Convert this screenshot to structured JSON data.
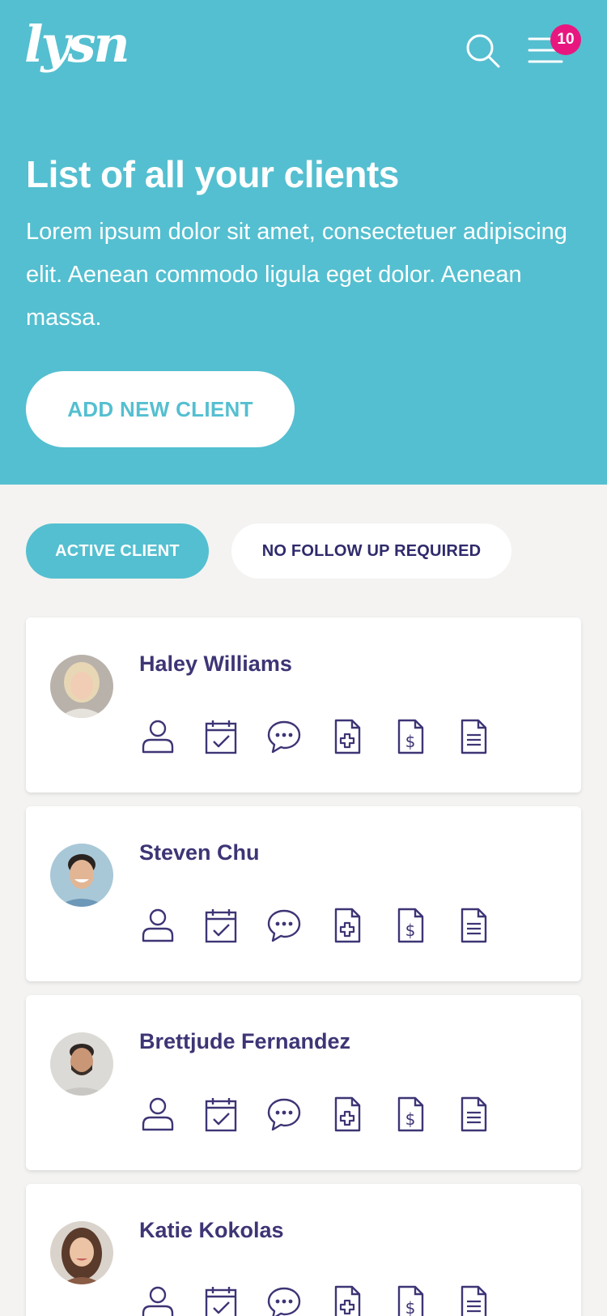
{
  "header": {
    "logo": "lysn",
    "notification_count": "10"
  },
  "hero": {
    "title": "List of all your clients",
    "description": "Lorem ipsum dolor sit amet, consectetuer adipiscing elit. Aenean commodo ligula eget dolor. Aenean massa.",
    "add_button": "ADD NEW CLIENT"
  },
  "filters": {
    "active": "ACTIVE CLIENT",
    "inactive": "NO FOLLOW UP REQUIRED"
  },
  "clients": [
    {
      "name": "Haley Williams"
    },
    {
      "name": "Steven Chu"
    },
    {
      "name": "Brettjude Fernandez"
    },
    {
      "name": "Katie Kokolas"
    }
  ],
  "action_icons": [
    "profile-icon",
    "calendar-check-icon",
    "chat-icon",
    "medical-document-icon",
    "invoice-document-icon",
    "notes-document-icon"
  ],
  "colors": {
    "brand": "#54bfd0",
    "badge": "#e8177f",
    "text_dark": "#3d3575",
    "background": "#f4f3f1"
  }
}
